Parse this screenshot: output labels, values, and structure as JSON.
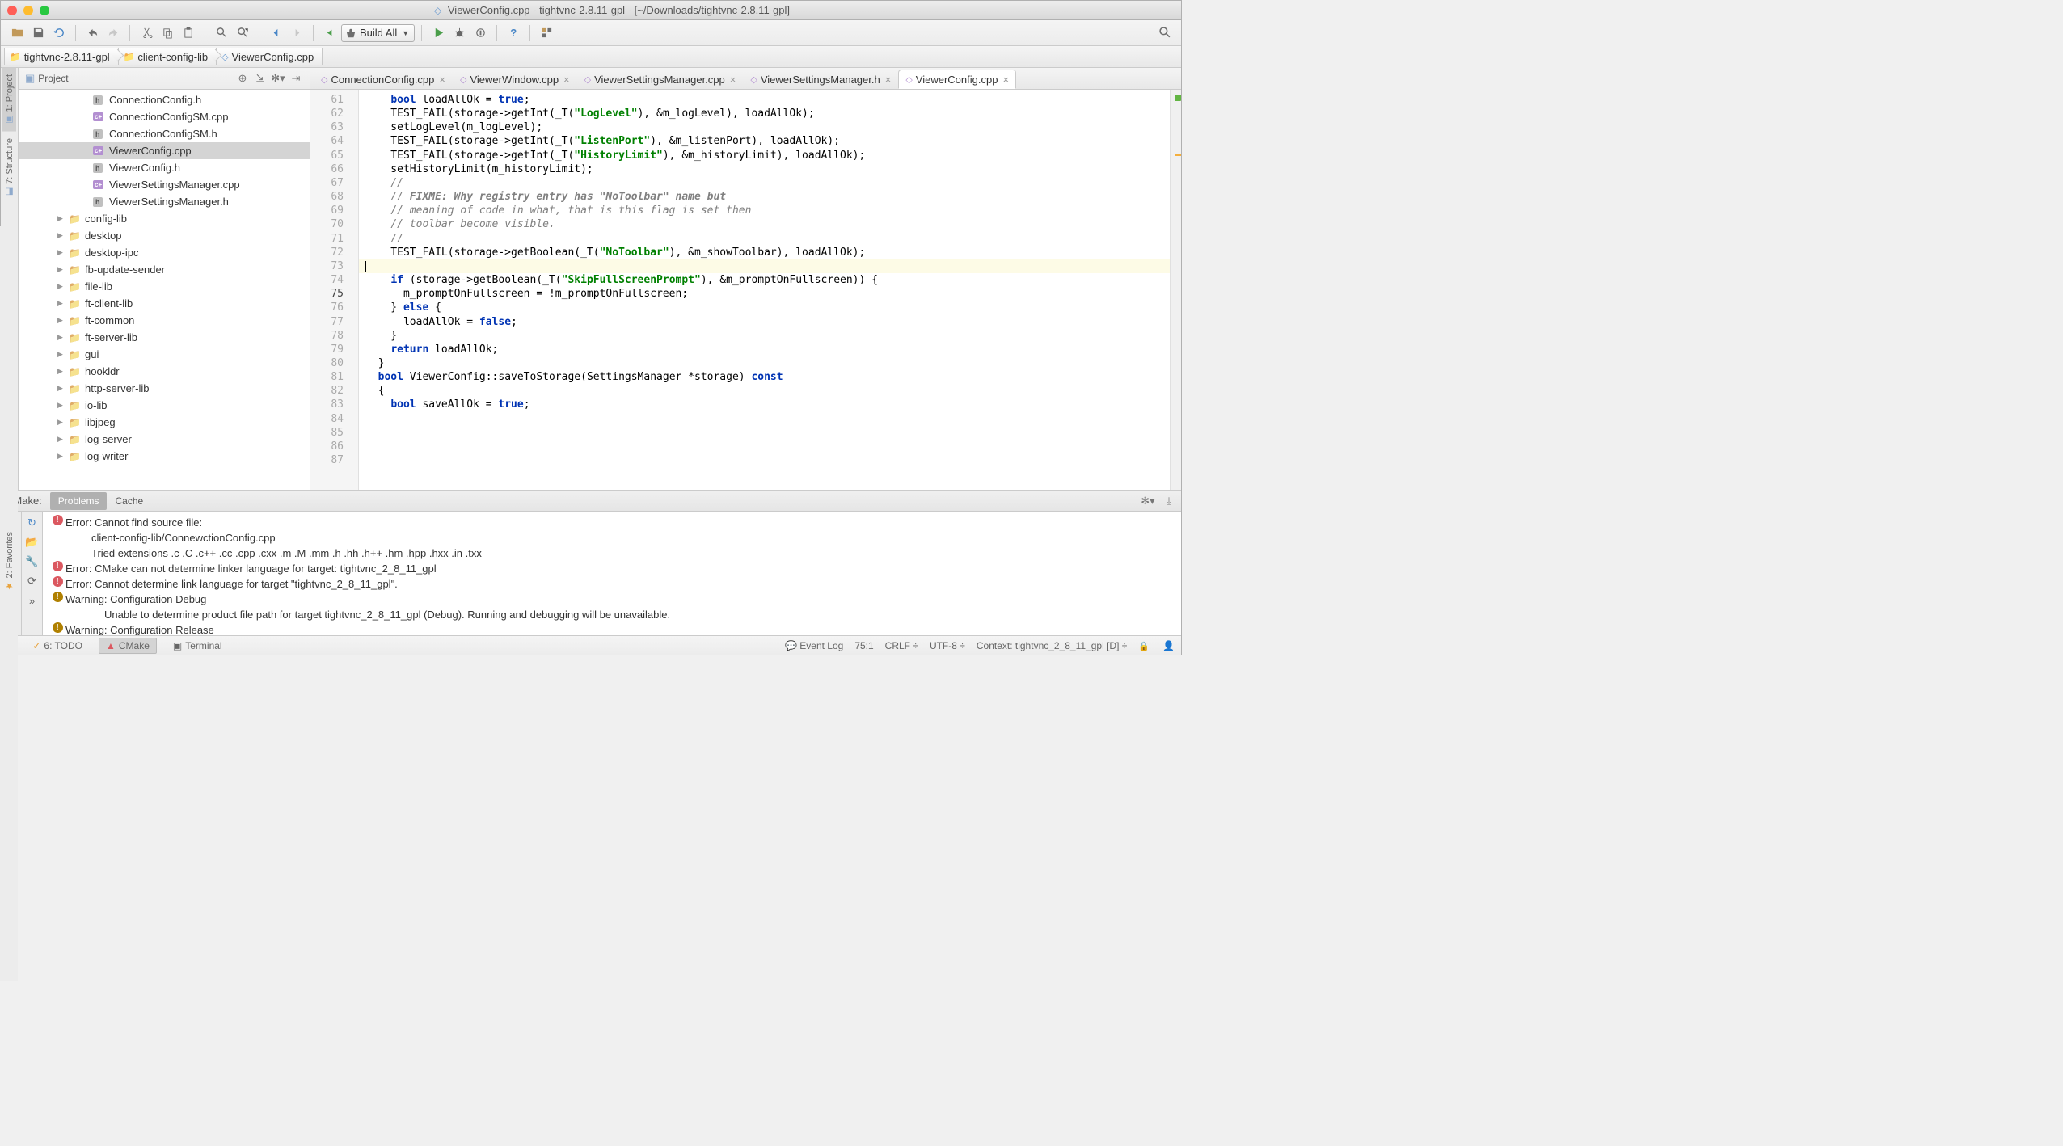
{
  "title": "ViewerConfig.cpp - tightvnc-2.8.11-gpl - [~/Downloads/tightvnc-2.8.11-gpl]",
  "toolbar": {
    "build_label": "Build All"
  },
  "breadcrumb": [
    {
      "icon": "folder",
      "label": "tightvnc-2.8.11-gpl"
    },
    {
      "icon": "folder",
      "label": "client-config-lib"
    },
    {
      "icon": "file",
      "label": "ViewerConfig.cpp"
    }
  ],
  "leftTabs": {
    "project": "1: Project",
    "structure": "7: Structure",
    "favorites": "2: Favorites"
  },
  "projectPanel": {
    "title": "Project"
  },
  "tree": {
    "files": [
      {
        "type": "h",
        "name": "ConnectionConfig.h"
      },
      {
        "type": "cpp",
        "name": "ConnectionConfigSM.cpp"
      },
      {
        "type": "h",
        "name": "ConnectionConfigSM.h"
      },
      {
        "type": "cpp",
        "name": "ViewerConfig.cpp",
        "selected": true
      },
      {
        "type": "h",
        "name": "ViewerConfig.h"
      },
      {
        "type": "cpp",
        "name": "ViewerSettingsManager.cpp"
      },
      {
        "type": "h",
        "name": "ViewerSettingsManager.h"
      }
    ],
    "folders": [
      "config-lib",
      "desktop",
      "desktop-ipc",
      "fb-update-sender",
      "file-lib",
      "ft-client-lib",
      "ft-common",
      "ft-server-lib",
      "gui",
      "hookldr",
      "http-server-lib",
      "io-lib",
      "libjpeg",
      "log-server",
      "log-writer"
    ]
  },
  "editorTabs": [
    {
      "label": "ConnectionConfig.cpp",
      "active": false
    },
    {
      "label": "ViewerWindow.cpp",
      "active": false
    },
    {
      "label": "ViewerSettingsManager.cpp",
      "active": false
    },
    {
      "label": "ViewerSettingsManager.h",
      "active": false
    },
    {
      "label": "ViewerConfig.cpp",
      "active": true
    }
  ],
  "code": {
    "startLine": 61,
    "currentLine": 75,
    "lines": [
      "    <kw>bool</kw> loadAllOk = <kw>true</kw>;",
      "",
      "    TEST_FAIL(storage->getInt(_T(<str>\"LogLevel\"</str>), &m_logLevel), loadAllOk);",
      "    setLogLevel(m_logLevel);",
      "    TEST_FAIL(storage->getInt(_T(<str>\"ListenPort\"</str>), &m_listenPort), loadAllOk);",
      "    TEST_FAIL(storage->getInt(_T(<str>\"HistoryLimit\"</str>), &m_historyLimit), loadAllOk);",
      "    setHistoryLimit(m_historyLimit);",
      "    <com>//</com>",
      "    <com>// </com><todo>FIXME: Why registry entry has \"NoToolbar\" name but</todo>",
      "    <com>// meaning of code in what, that is this flag is set then</com>",
      "    <com>// toolbar become visible.</com>",
      "    <com>//</com>",
      "",
      "    TEST_FAIL(storage->getBoolean(_T(<str>\"NoToolbar\"</str>), &m_showToolbar), loadAllOk);",
      "",
      "    <kw>if</kw> (storage->getBoolean(_T(<str>\"SkipFullScreenPrompt\"</str>), &m_promptOnFullscreen)) {",
      "      m_promptOnFullscreen = !m_promptOnFullscreen;",
      "    } <kw>else</kw> {",
      "      loadAllOk = <kw>false</kw>;",
      "    }",
      "",
      "    <kw>return</kw> loadAllOk;",
      "  }",
      "",
      "  <kw>bool</kw> ViewerConfig::saveToStorage(SettingsManager *storage) <kw>const</kw>",
      "  {",
      "    <kw>bool</kw> saveAllOk = <kw>true</kw>;"
    ]
  },
  "problemsPanel": {
    "title": "CMake:",
    "tabs": [
      "Problems",
      "Cache"
    ],
    "activeTab": 0,
    "messages": [
      {
        "icon": "err",
        "text": "Error: Cannot find source file:",
        "indent": 0
      },
      {
        "icon": "",
        "text": "client-config-lib/ConnewctionConfig.cpp",
        "indent": 1
      },
      {
        "icon": "",
        "text": "Tried extensions .c .C .c++ .cc .cpp .cxx .m .M .mm .h .hh .h++ .hm .hpp .hxx .in .txx",
        "indent": 1
      },
      {
        "icon": "err",
        "text": "Error: CMake can not determine linker language for target: tightvnc_2_8_11_gpl",
        "indent": 0
      },
      {
        "icon": "err",
        "text": "Error: Cannot determine link language for target \"tightvnc_2_8_11_gpl\".",
        "indent": 0
      },
      {
        "icon": "warn",
        "text": "Warning: Configuration Debug",
        "indent": 0
      },
      {
        "icon": "",
        "text": "Unable to determine product file path for target tightvnc_2_8_11_gpl (Debug). Running and debugging will be unavailable.",
        "indent": 2
      },
      {
        "icon": "warn",
        "text": "Warning: Configuration Release",
        "indent": 0
      }
    ]
  },
  "statusbar": {
    "todo": "6: TODO",
    "cmake": "CMake",
    "terminal": "Terminal",
    "eventLog": "Event Log",
    "pos": "75:1",
    "lineSep": "CRLF ÷",
    "encoding": "UTF-8 ÷",
    "context": "Context: tightvnc_2_8_11_gpl [D] ÷"
  }
}
